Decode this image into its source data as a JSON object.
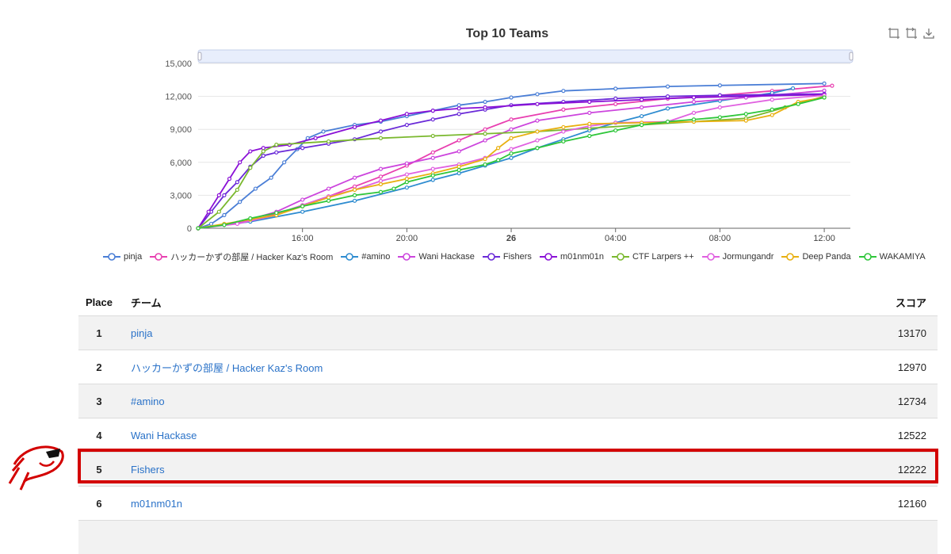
{
  "chart_data": {
    "type": "line",
    "title": "Top 10 Teams",
    "ylim": [
      0,
      15000
    ],
    "yticks": [
      "15,000",
      "12,000",
      "9,000",
      "6,000",
      "3,000",
      "0"
    ],
    "xticks": [
      "16:00",
      "20:00",
      "26",
      "04:00",
      "08:00",
      "12:00"
    ],
    "x_unit": "hours since 12:00 day 25",
    "series": [
      {
        "name": "pinja",
        "color": "#4a7ed6",
        "points": [
          [
            0,
            0
          ],
          [
            0.5,
            400
          ],
          [
            1,
            1200
          ],
          [
            1.6,
            2400
          ],
          [
            2.2,
            3600
          ],
          [
            2.8,
            4600
          ],
          [
            3.3,
            6000
          ],
          [
            3.8,
            7200
          ],
          [
            4.2,
            8200
          ],
          [
            4.8,
            8800
          ],
          [
            6,
            9400
          ],
          [
            7,
            9700
          ],
          [
            8,
            10200
          ],
          [
            9,
            10700
          ],
          [
            10,
            11200
          ],
          [
            11,
            11500
          ],
          [
            12,
            11900
          ],
          [
            13,
            12200
          ],
          [
            14,
            12500
          ],
          [
            16,
            12700
          ],
          [
            18,
            12900
          ],
          [
            20,
            13000
          ],
          [
            24,
            13170
          ]
        ]
      },
      {
        "name": "ハッカーかずの部屋 / Hacker Kaz's Room",
        "color": "#e83fb0",
        "points": [
          [
            0,
            0
          ],
          [
            1,
            300
          ],
          [
            2,
            700
          ],
          [
            3,
            1300
          ],
          [
            4,
            2100
          ],
          [
            5,
            2900
          ],
          [
            6,
            3800
          ],
          [
            7,
            4700
          ],
          [
            8,
            5700
          ],
          [
            9,
            6900
          ],
          [
            10,
            8000
          ],
          [
            11,
            9000
          ],
          [
            12,
            9900
          ],
          [
            14,
            10800
          ],
          [
            16,
            11300
          ],
          [
            18,
            11800
          ],
          [
            20,
            12100
          ],
          [
            22,
            12500
          ],
          [
            24.3,
            12970
          ]
        ]
      },
      {
        "name": "#amino",
        "color": "#2e8cd0",
        "points": [
          [
            0,
            0
          ],
          [
            2,
            600
          ],
          [
            4,
            1500
          ],
          [
            6,
            2500
          ],
          [
            8,
            3700
          ],
          [
            9,
            4400
          ],
          [
            10,
            5000
          ],
          [
            11,
            5700
          ],
          [
            12,
            6400
          ],
          [
            13,
            7300
          ],
          [
            14,
            8100
          ],
          [
            15,
            8900
          ],
          [
            16,
            9600
          ],
          [
            17,
            10200
          ],
          [
            18,
            10900
          ],
          [
            20,
            11600
          ],
          [
            22,
            12300
          ],
          [
            22.8,
            12734
          ]
        ]
      },
      {
        "name": "Wani Hackase",
        "color": "#cc44dd",
        "points": [
          [
            0,
            0
          ],
          [
            1.5,
            500
          ],
          [
            3,
            1500
          ],
          [
            4,
            2600
          ],
          [
            5,
            3600
          ],
          [
            6,
            4600
          ],
          [
            7,
            5400
          ],
          [
            8,
            5900
          ],
          [
            9,
            6400
          ],
          [
            10,
            7000
          ],
          [
            11,
            8000
          ],
          [
            12,
            9000
          ],
          [
            13,
            9800
          ],
          [
            15,
            10500
          ],
          [
            17,
            11000
          ],
          [
            19,
            11500
          ],
          [
            21,
            11900
          ],
          [
            24,
            12522
          ]
        ]
      },
      {
        "name": "Fishers",
        "color": "#6a2ad8",
        "points": [
          [
            0,
            0
          ],
          [
            0.5,
            1500
          ],
          [
            1,
            3000
          ],
          [
            1.5,
            4200
          ],
          [
            2,
            5600
          ],
          [
            2.5,
            6600
          ],
          [
            3,
            6900
          ],
          [
            4,
            7300
          ],
          [
            5,
            7700
          ],
          [
            6,
            8100
          ],
          [
            7,
            8800
          ],
          [
            8,
            9400
          ],
          [
            9,
            9900
          ],
          [
            10,
            10400
          ],
          [
            11,
            10800
          ],
          [
            12,
            11200
          ],
          [
            14,
            11500
          ],
          [
            16,
            11800
          ],
          [
            18,
            12000
          ],
          [
            20,
            12100
          ],
          [
            24,
            12222
          ]
        ]
      },
      {
        "name": "m01nm01n",
        "color": "#8a10d6",
        "points": [
          [
            0,
            0
          ],
          [
            0.4,
            1500
          ],
          [
            0.8,
            3000
          ],
          [
            1.2,
            4500
          ],
          [
            1.6,
            6000
          ],
          [
            2,
            7000
          ],
          [
            2.5,
            7300
          ],
          [
            3.5,
            7600
          ],
          [
            4.5,
            8200
          ],
          [
            6,
            9200
          ],
          [
            7,
            9800
          ],
          [
            8,
            10400
          ],
          [
            9,
            10700
          ],
          [
            10,
            10900
          ],
          [
            11,
            11000
          ],
          [
            13,
            11300
          ],
          [
            15,
            11500
          ],
          [
            17,
            11700
          ],
          [
            19,
            11900
          ],
          [
            24,
            12160
          ]
        ]
      },
      {
        "name": "CTF Larpers ++",
        "color": "#7ab82e",
        "points": [
          [
            0,
            0
          ],
          [
            0.8,
            1500
          ],
          [
            1.5,
            3500
          ],
          [
            2,
            5500
          ],
          [
            2.5,
            7000
          ],
          [
            3,
            7600
          ],
          [
            5,
            7900
          ],
          [
            7,
            8200
          ],
          [
            9,
            8400
          ],
          [
            11,
            8600
          ],
          [
            13,
            8800
          ],
          [
            15,
            9100
          ],
          [
            17,
            9400
          ],
          [
            19,
            9700
          ],
          [
            21,
            10000
          ],
          [
            22.5,
            11000
          ],
          [
            24,
            12000
          ]
        ]
      },
      {
        "name": "Jormungandr",
        "color": "#e060e0",
        "points": [
          [
            0,
            0
          ],
          [
            1.5,
            400
          ],
          [
            3,
            1200
          ],
          [
            4,
            2100
          ],
          [
            5,
            2900
          ],
          [
            6,
            3500
          ],
          [
            7,
            4300
          ],
          [
            8,
            4900
          ],
          [
            9,
            5400
          ],
          [
            10,
            5800
          ],
          [
            11,
            6400
          ],
          [
            12,
            7200
          ],
          [
            13,
            8000
          ],
          [
            14,
            8800
          ],
          [
            15,
            9300
          ],
          [
            16,
            9600
          ],
          [
            18,
            9700
          ],
          [
            19,
            10500
          ],
          [
            20,
            11000
          ],
          [
            22,
            11700
          ],
          [
            24,
            12100
          ]
        ]
      },
      {
        "name": "Deep Panda",
        "color": "#e8b010",
        "points": [
          [
            0,
            0
          ],
          [
            1,
            400
          ],
          [
            2,
            800
          ],
          [
            3,
            1200
          ],
          [
            4,
            2000
          ],
          [
            5,
            2800
          ],
          [
            6,
            3500
          ],
          [
            7,
            4000
          ],
          [
            8,
            4500
          ],
          [
            9,
            5000
          ],
          [
            10,
            5600
          ],
          [
            11,
            6300
          ],
          [
            11.5,
            7300
          ],
          [
            12,
            8200
          ],
          [
            13,
            8800
          ],
          [
            14,
            9200
          ],
          [
            15,
            9500
          ],
          [
            17,
            9600
          ],
          [
            19,
            9700
          ],
          [
            21,
            9800
          ],
          [
            22,
            10300
          ],
          [
            23,
            11500
          ],
          [
            24,
            11900
          ]
        ]
      },
      {
        "name": "WAKAMIYA",
        "color": "#2ec63a",
        "points": [
          [
            0,
            0
          ],
          [
            1,
            300
          ],
          [
            2,
            900
          ],
          [
            3,
            1400
          ],
          [
            4,
            2000
          ],
          [
            5,
            2500
          ],
          [
            6,
            3000
          ],
          [
            7,
            3300
          ],
          [
            7.5,
            3600
          ],
          [
            8,
            4200
          ],
          [
            9,
            4800
          ],
          [
            10,
            5300
          ],
          [
            11,
            5800
          ],
          [
            11.5,
            6200
          ],
          [
            12,
            6800
          ],
          [
            13,
            7300
          ],
          [
            14,
            7900
          ],
          [
            15,
            8400
          ],
          [
            16,
            8900
          ],
          [
            17,
            9400
          ],
          [
            18,
            9700
          ],
          [
            19,
            9900
          ],
          [
            20,
            10100
          ],
          [
            21,
            10400
          ],
          [
            22,
            10800
          ],
          [
            23,
            11300
          ],
          [
            24,
            11900
          ]
        ]
      }
    ]
  },
  "table": {
    "headers": {
      "place": "Place",
      "team": "チーム",
      "score": "スコア"
    },
    "rows": [
      {
        "place": "1",
        "team": "pinja",
        "score": "13170"
      },
      {
        "place": "2",
        "team": "ハッカーかずの部屋 / Hacker Kaz's Room",
        "score": "12970"
      },
      {
        "place": "3",
        "team": "#amino",
        "score": "12734"
      },
      {
        "place": "4",
        "team": "Wani Hackase",
        "score": "12522"
      },
      {
        "place": "5",
        "team": "Fishers",
        "score": "12222"
      },
      {
        "place": "6",
        "team": "m01nm01n",
        "score": "12160"
      }
    ],
    "highlight_color": "#d30000"
  },
  "toolbox": {
    "icons": [
      "zoom-area-icon",
      "zoom-reset-icon",
      "download-icon"
    ]
  }
}
